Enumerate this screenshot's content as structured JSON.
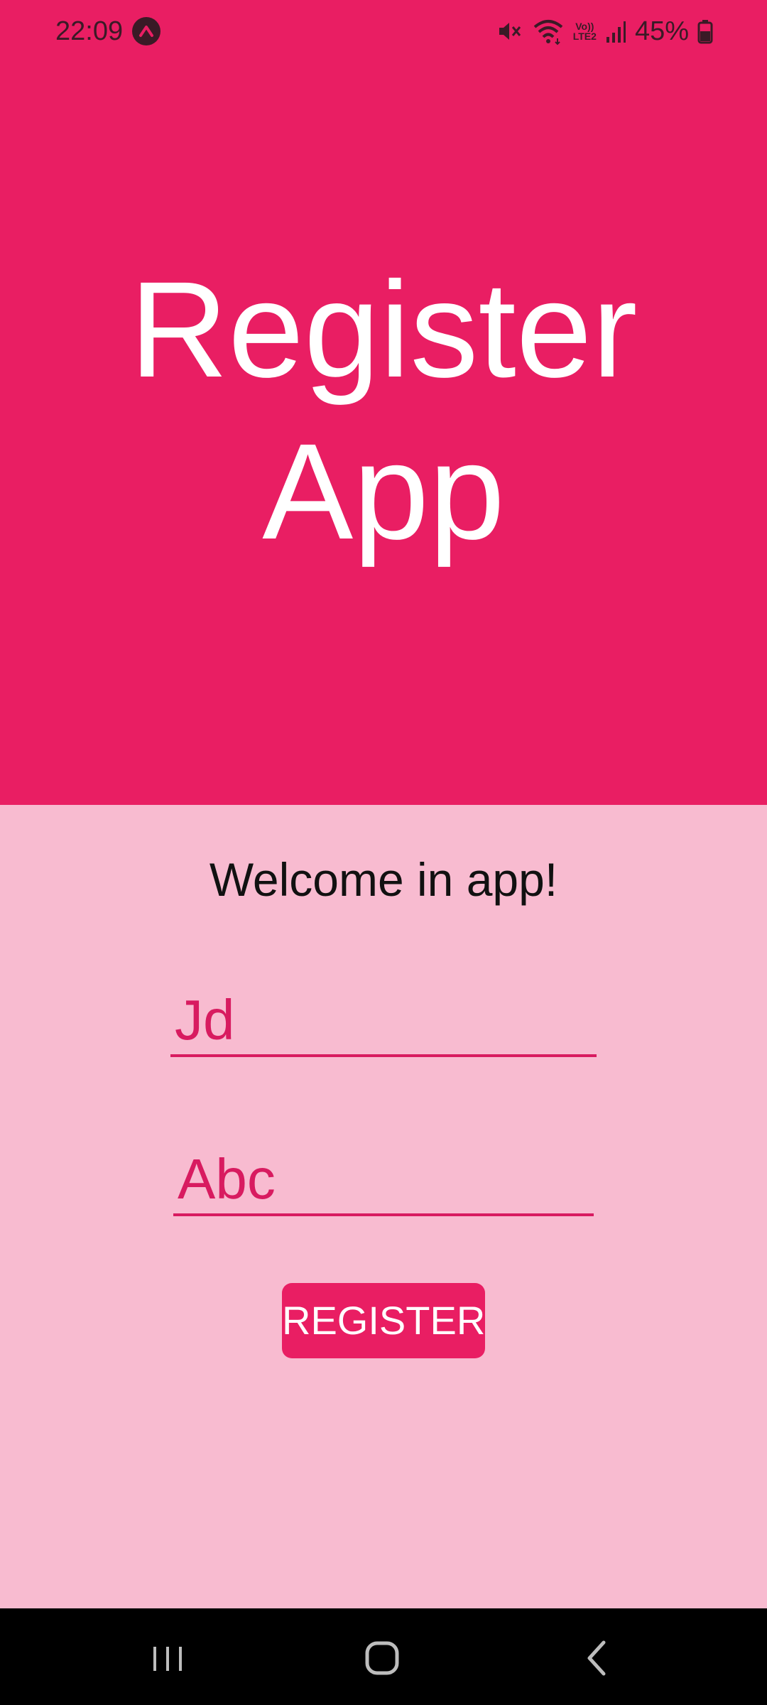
{
  "status_bar": {
    "time": "22:09",
    "network_label": "Vo))\nLTE2",
    "battery": "45%"
  },
  "header": {
    "title_line1": "Register",
    "title_line2": "App",
    "background_color": "#e91e63"
  },
  "main": {
    "welcome_text": "Welcome in app!",
    "username_value": "Jd",
    "password_value": "Abc",
    "register_label": "REGISTER",
    "background_color": "#f8bbd0",
    "accent_color": "#d81b60"
  },
  "nav_bar": {
    "recents_icon": "recents-icon",
    "home_icon": "home-icon",
    "back_icon": "back-icon"
  }
}
